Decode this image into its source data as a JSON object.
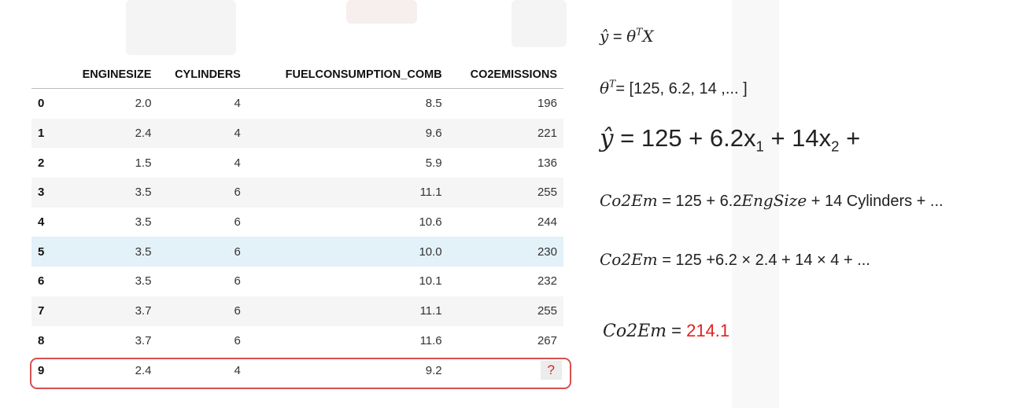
{
  "table": {
    "columns": [
      "",
      "ENGINESIZE",
      "CYLINDERS",
      "FUELCONSUMPTION_COMB",
      "CO2EMISSIONS"
    ],
    "rows": [
      {
        "index": "0",
        "enginesize": "2.0",
        "cylinders": "4",
        "fuel": "8.5",
        "co2": "196"
      },
      {
        "index": "1",
        "enginesize": "2.4",
        "cylinders": "4",
        "fuel": "9.6",
        "co2": "221"
      },
      {
        "index": "2",
        "enginesize": "1.5",
        "cylinders": "4",
        "fuel": "5.9",
        "co2": "136"
      },
      {
        "index": "3",
        "enginesize": "3.5",
        "cylinders": "6",
        "fuel": "11.1",
        "co2": "255"
      },
      {
        "index": "4",
        "enginesize": "3.5",
        "cylinders": "6",
        "fuel": "10.6",
        "co2": "244"
      },
      {
        "index": "5",
        "enginesize": "3.5",
        "cylinders": "6",
        "fuel": "10.0",
        "co2": "230"
      },
      {
        "index": "6",
        "enginesize": "3.5",
        "cylinders": "6",
        "fuel": "10.1",
        "co2": "232"
      },
      {
        "index": "7",
        "enginesize": "3.7",
        "cylinders": "6",
        "fuel": "11.1",
        "co2": "255"
      },
      {
        "index": "8",
        "enginesize": "3.7",
        "cylinders": "6",
        "fuel": "11.6",
        "co2": "267"
      },
      {
        "index": "9",
        "enginesize": "2.4",
        "cylinders": "4",
        "fuel": "9.2",
        "co2": "?"
      }
    ],
    "highlight_row": "5",
    "query_row": "9"
  },
  "equations": {
    "eq1": {
      "yhat": "ŷ",
      "equals": " = ",
      "theta": "θ",
      "T": "T",
      "X": "X"
    },
    "eq2": {
      "theta": "θ",
      "T": "T",
      "rest": "= [125, 6.2, 14 ,... ]"
    },
    "eq3": {
      "yhat": "ŷ",
      "a": " = 125 + 6.2x",
      "sub1": "1",
      "b": " + 14x",
      "sub2": "2",
      "c": " +"
    },
    "eq4": {
      "lhs": "Co2Em",
      "eq": " = 125 + 6.2",
      "eng": "EngSize",
      "rest": " + 14 Cylinders + ..."
    },
    "eq5": {
      "lhs": "Co2Em",
      "rest": " = 125 +6.2 × 2.4 + 14 × 4 + ..."
    },
    "eq6": {
      "lhs": "Co2Em",
      "eq": " = ",
      "result": "214.1"
    }
  },
  "colors": {
    "highlight": "#e3f1f8",
    "outline": "#d65050",
    "result": "#e02020"
  }
}
